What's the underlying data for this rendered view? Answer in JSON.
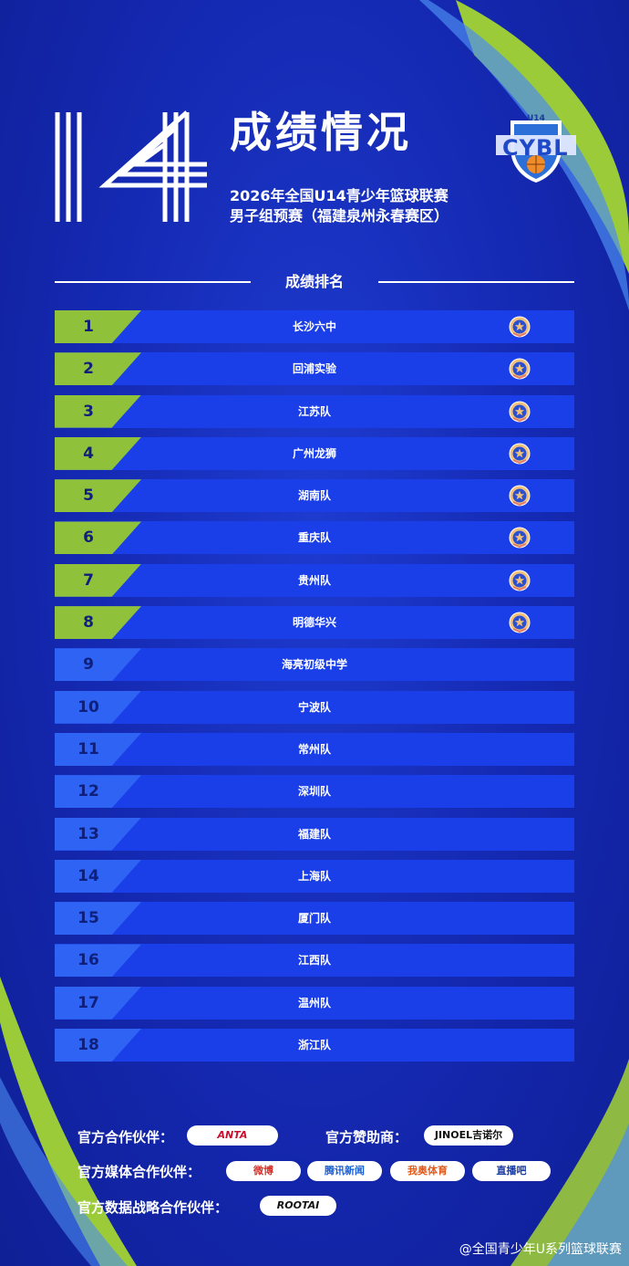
{
  "header": {
    "number": "14",
    "title": "成绩情况",
    "subtitle_line1": "2026年全国U14青少年篮球联赛",
    "subtitle_line2": "男子组预赛（福建泉州永春赛区）",
    "logo_text": "CYBL",
    "logo_small": "U14"
  },
  "section_title": "成绩排名",
  "rankings": [
    {
      "rank": "1",
      "team": "长沙六中",
      "advanced": true
    },
    {
      "rank": "2",
      "team": "回浦实验",
      "advanced": true
    },
    {
      "rank": "3",
      "team": "江苏队",
      "advanced": true
    },
    {
      "rank": "4",
      "team": "广州龙狮",
      "advanced": true
    },
    {
      "rank": "5",
      "team": "湖南队",
      "advanced": true
    },
    {
      "rank": "6",
      "team": "重庆队",
      "advanced": true
    },
    {
      "rank": "7",
      "team": "贵州队",
      "advanced": true
    },
    {
      "rank": "8",
      "team": "明德华兴",
      "advanced": true
    },
    {
      "rank": "9",
      "team": "海亮初级中学",
      "advanced": false
    },
    {
      "rank": "10",
      "team": "宁波队",
      "advanced": false
    },
    {
      "rank": "11",
      "team": "常州队",
      "advanced": false
    },
    {
      "rank": "12",
      "team": "深圳队",
      "advanced": false
    },
    {
      "rank": "13",
      "team": "福建队",
      "advanced": false
    },
    {
      "rank": "14",
      "team": "上海队",
      "advanced": false
    },
    {
      "rank": "15",
      "team": "厦门队",
      "advanced": false
    },
    {
      "rank": "16",
      "team": "江西队",
      "advanced": false
    },
    {
      "rank": "17",
      "team": "温州队",
      "advanced": false
    },
    {
      "rank": "18",
      "team": "浙江队",
      "advanced": false
    }
  ],
  "sponsors": {
    "partner_label": "官方合作伙伴：",
    "partner_logo": "ANTA",
    "sponsor_label": "官方赞助商：",
    "sponsor_logo": "JINOEL吉诺尔",
    "media_label": "官方媒体合作伙伴：",
    "media_logos": [
      "微博",
      "腾讯新闻",
      "我奥体育",
      "直播吧"
    ],
    "data_label": "官方数据战略合作伙伴：",
    "data_logo": "ROOTAI"
  },
  "footer": "@全国青少年U系列篮球联赛",
  "colors": {
    "green": "#8fc23a",
    "bar_blue": "#1a3ee8",
    "bg": "#1428b0"
  }
}
